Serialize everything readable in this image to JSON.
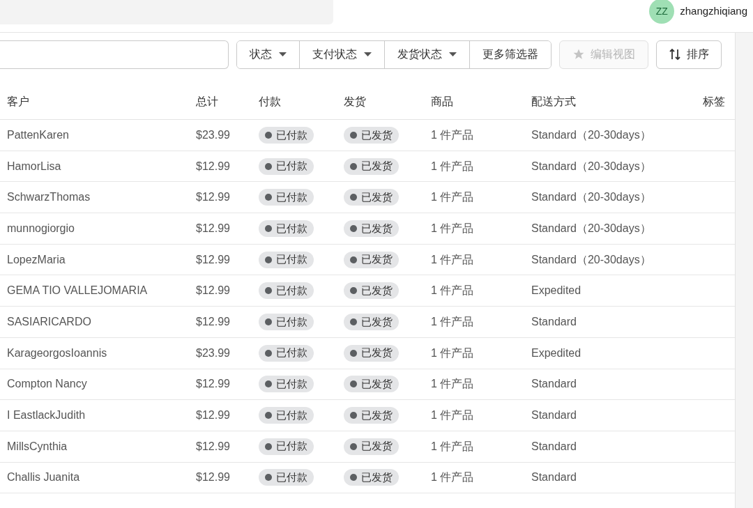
{
  "user": {
    "initials": "ZZ",
    "name": "zhangzhiqiang"
  },
  "toolbar": {
    "filters": [
      {
        "label": "状态",
        "dropdown": true
      },
      {
        "label": "支付状态",
        "dropdown": true
      },
      {
        "label": "发货状态",
        "dropdown": true
      },
      {
        "label": "更多筛选器",
        "dropdown": false
      }
    ],
    "edit_view": {
      "label": "编辑视图",
      "disabled": true
    },
    "sort": {
      "label": "排序"
    }
  },
  "table": {
    "columns": [
      "客户",
      "总计",
      "付款",
      "发货",
      "商品",
      "配送方式",
      "标签"
    ],
    "rows": [
      {
        "customer": "PattenKaren",
        "total": "$23.99",
        "payment": "已付款",
        "fulfillment": "已发货",
        "items": "1 件产品",
        "delivery": "Standard（20-30days）"
      },
      {
        "customer": "HamorLisa",
        "total": "$12.99",
        "payment": "已付款",
        "fulfillment": "已发货",
        "items": "1 件产品",
        "delivery": "Standard（20-30days）"
      },
      {
        "customer": "SchwarzThomas",
        "total": "$12.99",
        "payment": "已付款",
        "fulfillment": "已发货",
        "items": "1 件产品",
        "delivery": "Standard（20-30days）"
      },
      {
        "customer": "munnogiorgio",
        "total": "$12.99",
        "payment": "已付款",
        "fulfillment": "已发货",
        "items": "1 件产品",
        "delivery": "Standard（20-30days）"
      },
      {
        "customer": "LopezMaria",
        "total": "$12.99",
        "payment": "已付款",
        "fulfillment": "已发货",
        "items": "1 件产品",
        "delivery": "Standard（20-30days）"
      },
      {
        "customer": "GEMA TIO VALLEJOMARIA",
        "total": "$12.99",
        "payment": "已付款",
        "fulfillment": "已发货",
        "items": "1 件产品",
        "delivery": "Expedited"
      },
      {
        "customer": "SASIARICARDO",
        "total": "$12.99",
        "payment": "已付款",
        "fulfillment": "已发货",
        "items": "1 件产品",
        "delivery": "Standard"
      },
      {
        "customer": "KarageorgosIoannis",
        "total": "$23.99",
        "payment": "已付款",
        "fulfillment": "已发货",
        "items": "1 件产品",
        "delivery": "Expedited"
      },
      {
        "customer": "Compton Nancy",
        "total": "$12.99",
        "payment": "已付款",
        "fulfillment": "已发货",
        "items": "1 件产品",
        "delivery": "Standard"
      },
      {
        "customer": "I EastlackJudith",
        "total": "$12.99",
        "payment": "已付款",
        "fulfillment": "已发货",
        "items": "1 件产品",
        "delivery": "Standard"
      },
      {
        "customer": "MillsCynthia",
        "total": "$12.99",
        "payment": "已付款",
        "fulfillment": "已发货",
        "items": "1 件产品",
        "delivery": "Standard"
      },
      {
        "customer": "Challis Juanita",
        "total": "$12.99",
        "payment": "已付款",
        "fulfillment": "已发货",
        "items": "1 件产品",
        "delivery": "Standard"
      }
    ]
  }
}
